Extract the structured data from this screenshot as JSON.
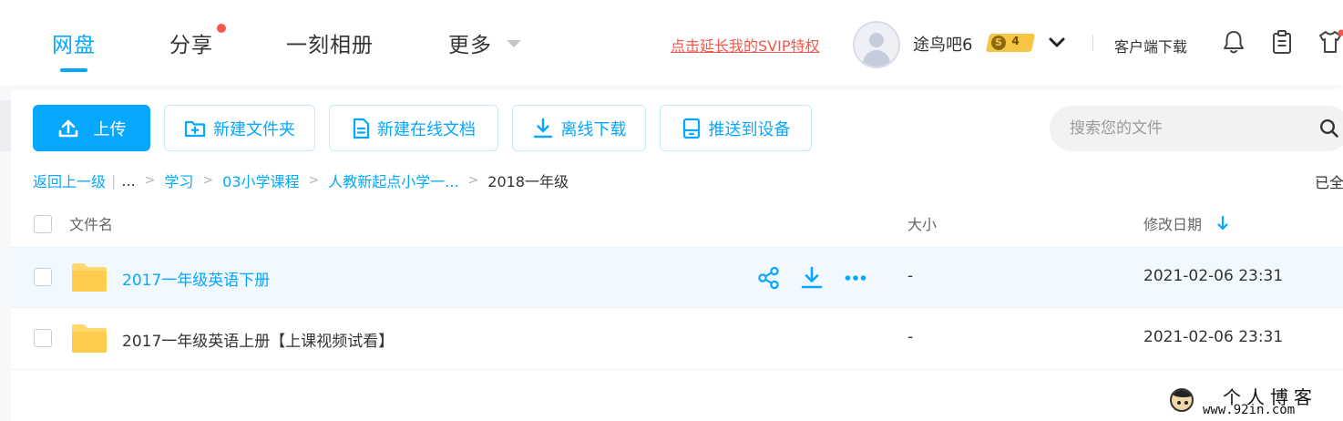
{
  "nav": {
    "items": [
      {
        "label": "网盘",
        "active": true
      },
      {
        "label": "分享",
        "has_dot": true
      },
      {
        "label": "一刻相册"
      },
      {
        "label": "更多"
      }
    ],
    "svip_link": "点击延长我的SVIP特权",
    "username": "途鸟吧6",
    "vip_badge": {
      "letter": "S",
      "level": "4",
      "color": "#f6c543"
    },
    "client_download": "客户端下载",
    "icons": [
      "bell-icon",
      "clipboard-icon",
      "tshirt-icon"
    ]
  },
  "toolbar": {
    "upload_label": "上传",
    "new_folder_label": "新建文件夹",
    "new_doc_label": "新建在线文档",
    "offline_download_label": "离线下载",
    "push_device_label": "推送到设备",
    "search_placeholder": "搜索您的文件"
  },
  "breadcrumb": {
    "back": "返回上一级",
    "bar": "|",
    "ellipsis": "...",
    "sep": ">",
    "items": [
      "学习",
      "03小学课程",
      "人教新起点小学一..."
    ],
    "current": "2018一年级",
    "loaded_text": "已全"
  },
  "table": {
    "headers": {
      "name": "文件名",
      "size": "大小",
      "date": "修改日期"
    },
    "rows": [
      {
        "name": "2017一年级英语下册",
        "size": "-",
        "date": "2021-02-06 23:31",
        "hover": true
      },
      {
        "name": "2017一年级英语上册【上课视频试看】",
        "size": "-",
        "date": "2021-02-06 23:31",
        "hover": false
      }
    ]
  },
  "watermark": {
    "title": "个人博客",
    "url": "www.92in.com"
  },
  "colors": {
    "accent": "#06a7ff",
    "svip_red": "#f0584c",
    "folder": "#ffd76a",
    "hover_row": "#f1f9ff"
  }
}
